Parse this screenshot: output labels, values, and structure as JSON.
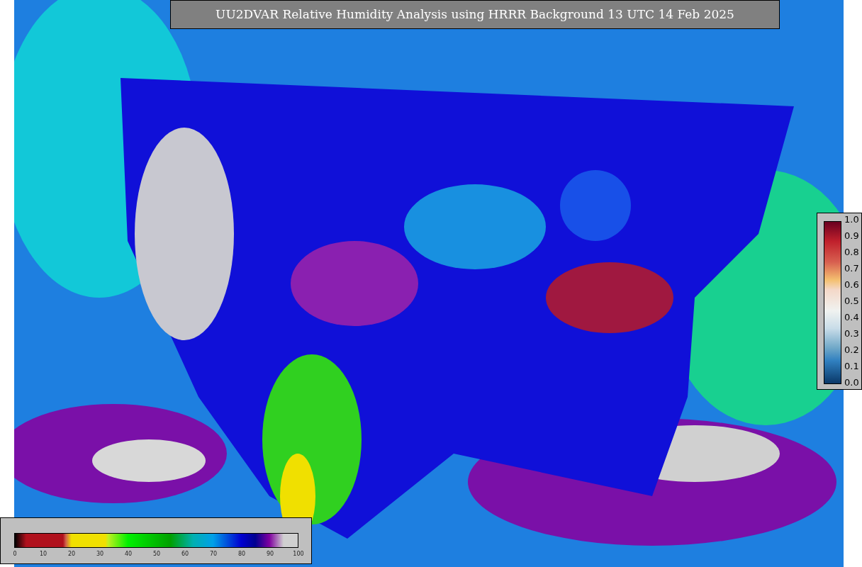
{
  "title": "UU2DVAR Relative Humidity Analysis using HRRR Background 13 UTC 14 Feb 2025",
  "humidity_colorbar": {
    "ticks": [
      "0",
      "10",
      "20",
      "30",
      "40",
      "50",
      "60",
      "70",
      "80",
      "90",
      "100"
    ]
  },
  "fraction_colorbar": {
    "ticks": [
      "1.0",
      "0.9",
      "0.8",
      "0.7",
      "0.6",
      "0.5",
      "0.4",
      "0.3",
      "0.2",
      "0.1",
      "0.0"
    ]
  }
}
